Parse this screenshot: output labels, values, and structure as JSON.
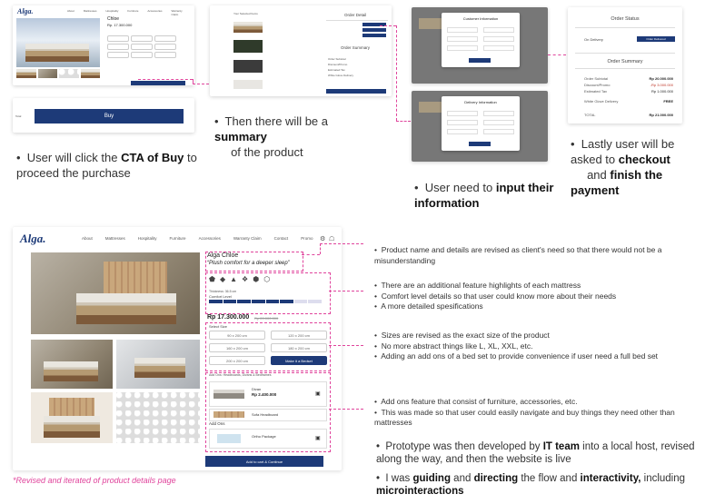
{
  "brand": "Alga.",
  "nav": [
    "About",
    "Mattresses",
    "Hospitality",
    "Furniture",
    "Accessories",
    "Warranty Claim",
    "Contact",
    "Promo"
  ],
  "top": {
    "step1_bullet": [
      "User will click the ",
      "CTA of Buy",
      " to proceed the purchase"
    ],
    "step2_bullet": [
      "Then there will be a ",
      "summary",
      " of the product"
    ],
    "step3_bullet": [
      "User need to ",
      "input their information"
    ],
    "step4_bullet": [
      "Lastly user will be asked to ",
      "checkout",
      " and ",
      "finish the payment"
    ],
    "mini_product_name": "Chloe",
    "mini_price": "Rp. 17.300.000",
    "buy_label": "Buy",
    "order_detail_title": "Order Detail",
    "order_summary_title": "Order Summary",
    "customer_info_title": "Customer Information",
    "delivery_info_title": "Delivery Information",
    "order_status_title": "Order Status",
    "on_delivery_label": "On Delivery",
    "status_badge": "Order Delivered",
    "summary_rows": [
      {
        "label": "Order Subtotal",
        "value": "Rp 20.000.000"
      },
      {
        "label": "Discount/Promo",
        "value": "-Rp 3.000.000"
      },
      {
        "label": "Estimated Tax",
        "value": "Rp 1.000.000"
      },
      {
        "label": "White Glove Delivery",
        "value": "FREE"
      },
      {
        "label": "TOTAL",
        "value": "Rp 21.000.000"
      }
    ]
  },
  "product": {
    "name": "Alga Chloe",
    "tagline": "Plush comfort for a deeper sleep",
    "comfort_label": "Comfort Level",
    "thickness": "Thickness: 36.5 cm",
    "price": "Rp 17.300.000",
    "old_price": "Rp 20.000.000",
    "select_size_label": "Select Size",
    "sizes": [
      "90 x 200 cm",
      "120 x 200 cm",
      "160 x 200 cm",
      "180 x 200 cm",
      "200 x 200 cm",
      "Make it a Bedset"
    ],
    "addon_header": "Add Ons: Headboards, Divans & Bedframes",
    "addon_items": [
      {
        "name": "Divan",
        "price": "Rp 2.400.000"
      },
      {
        "name": "Sofa Headboard",
        "price": ""
      },
      {
        "name": "Ortho Package",
        "price": ""
      }
    ],
    "addon_tab": "Add Ons",
    "cta": "Add to cart & Continue"
  },
  "notes": [
    "Product name and details are revised as client's need so that there would not be a misunderstanding",
    "There are an additional feature highlights of each mattress",
    "Comfort level details so that user could know more about their needs",
    "A more detailed spesifications",
    "Sizes are revised as the exact size of the product",
    "No more abstract things like L, XL, XXL, etc.",
    "Adding an add ons of a bed set to provide convenience if user need a full bed set",
    "Add ons feature that consist of furniture, accessories, etc.",
    "This was made so that user could easily navigate and buy things they need other than mattresses"
  ],
  "closing": [
    [
      "Prototype was then developed by ",
      "IT team",
      " into a local host, revised along the way, and then the website is live"
    ],
    [
      "I was ",
      "guiding",
      " and ",
      "directing",
      " the flow and ",
      "interactivity,",
      " including ",
      "microinteractions"
    ]
  ],
  "caption": "*Revised and iterated of product details page",
  "colors": {
    "brand": "#1d3a78",
    "accent": "#e0449c",
    "caption": "#e0449c"
  }
}
